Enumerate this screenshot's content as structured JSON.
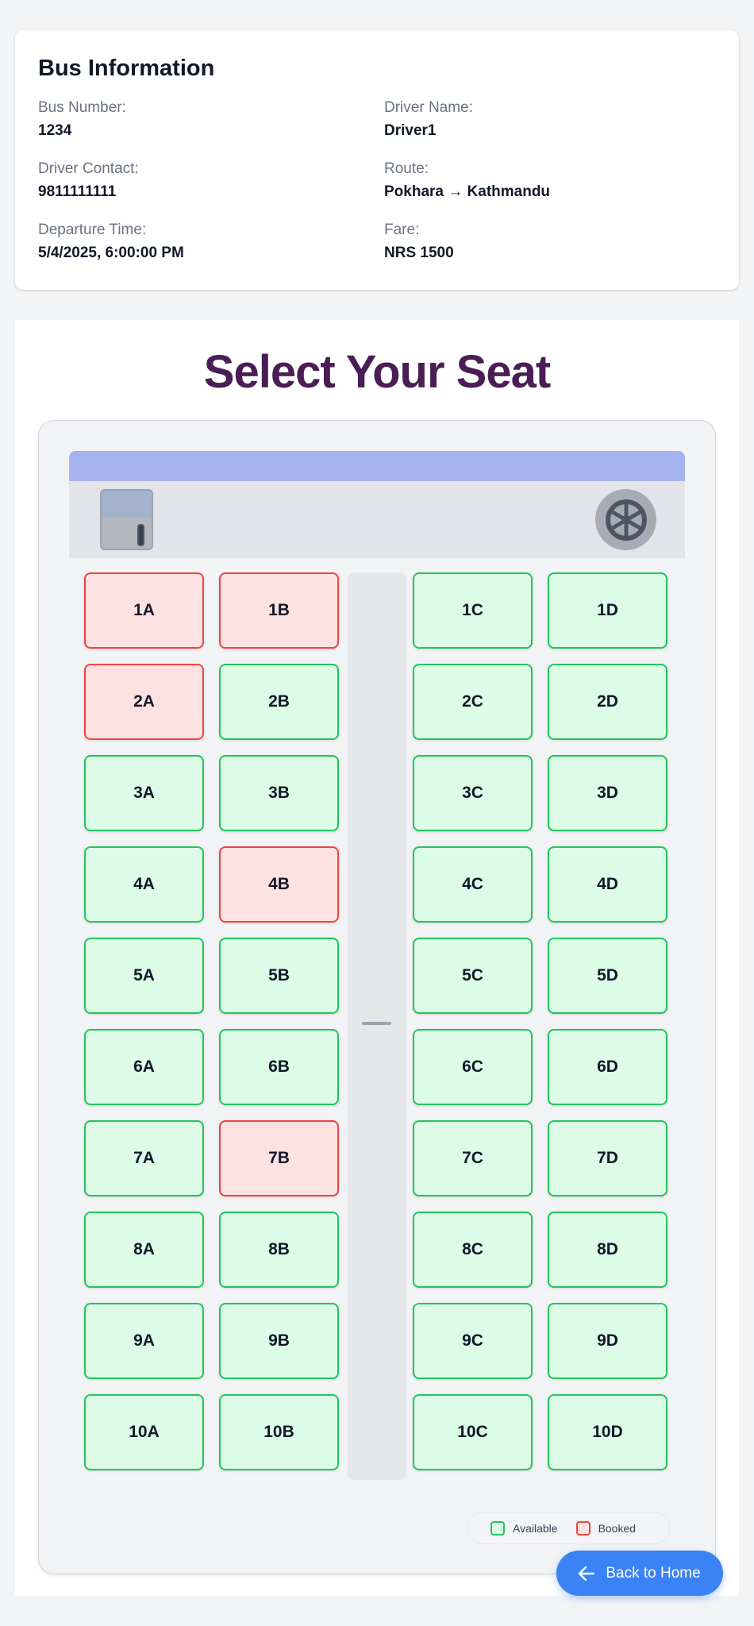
{
  "bus_info": {
    "title": "Bus Information",
    "bus_number": {
      "label": "Bus Number:",
      "value": "1234"
    },
    "driver_name": {
      "label": "Driver Name:",
      "value": "Driver1"
    },
    "driver_contact": {
      "label": "Driver Contact:",
      "value": "9811111111"
    },
    "route": {
      "label": "Route:",
      "value": "Pokhara → Kathmandu"
    },
    "departure_time": {
      "label": "Departure Time:",
      "value": "5/4/2025, 6:00:00 PM"
    },
    "fare": {
      "label": "Fare:",
      "value": "NRS 1500"
    }
  },
  "seat_selection": {
    "title": "Select Your Seat",
    "rows": [
      [
        "1A",
        "1B",
        "1C",
        "1D"
      ],
      [
        "2A",
        "2B",
        "2C",
        "2D"
      ],
      [
        "3A",
        "3B",
        "3C",
        "3D"
      ],
      [
        "4A",
        "4B",
        "4C",
        "4D"
      ],
      [
        "5A",
        "5B",
        "5C",
        "5D"
      ],
      [
        "6A",
        "6B",
        "6C",
        "6D"
      ],
      [
        "7A",
        "7B",
        "7C",
        "7D"
      ],
      [
        "8A",
        "8B",
        "8C",
        "8D"
      ],
      [
        "9A",
        "9B",
        "9C",
        "9D"
      ],
      [
        "10A",
        "10B",
        "10C",
        "10D"
      ]
    ],
    "booked_seats": [
      "1A",
      "1B",
      "2A",
      "4B",
      "7B"
    ]
  },
  "legend": {
    "available_label": "Available",
    "booked_label": "Booked"
  },
  "colors": {
    "available_bg": "#dcfce7",
    "available_border": "#22c55e",
    "booked_bg": "#fee2e2",
    "booked_border": "#ef4444",
    "title": "#4a1d55",
    "button": "#3b82f6"
  },
  "icons": {
    "door": "door-icon",
    "steering": "steering-wheel-icon",
    "back": "arrow-left-icon"
  },
  "actions": {
    "back_label": "Back to Home"
  }
}
